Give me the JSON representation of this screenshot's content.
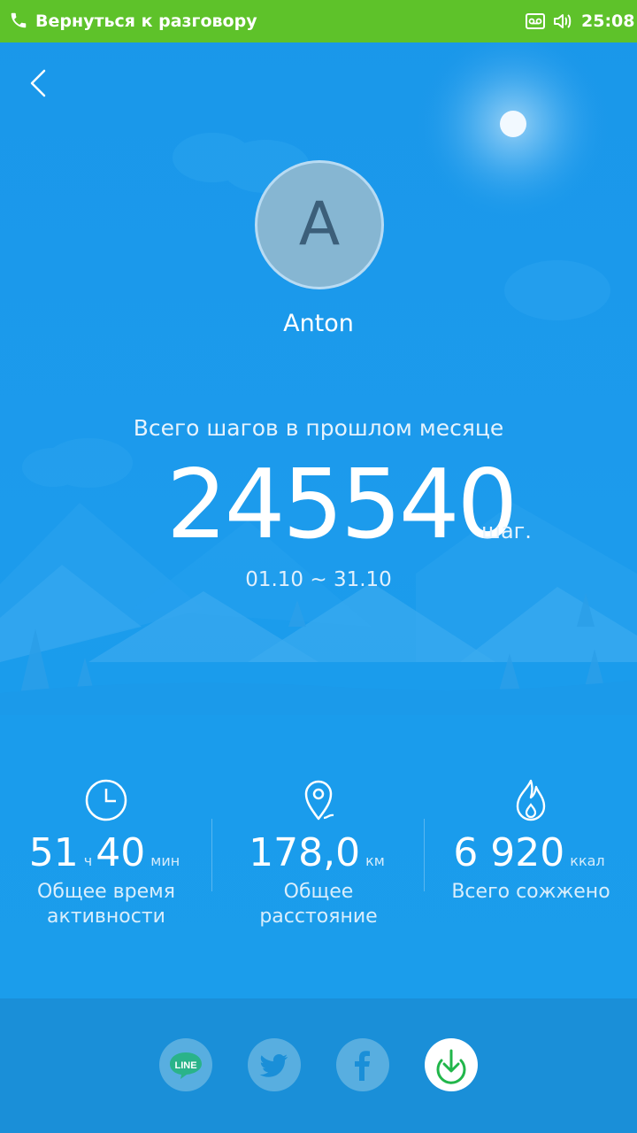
{
  "status_bar": {
    "call_text": "Вернуться к разговору",
    "time": "25:08",
    "icons": [
      "phone-icon",
      "voicemail-icon",
      "volume-icon"
    ]
  },
  "header": {
    "back_icon": "chevron-left-icon"
  },
  "profile": {
    "avatar_letter": "A",
    "name": "Anton"
  },
  "summary": {
    "label": "Всего шагов в прошлом месяце",
    "steps": "245540",
    "unit": "шаг.",
    "period": "01.10 ~ 31.10"
  },
  "stats": [
    {
      "icon": "clock-icon",
      "hours": "51",
      "hours_unit": "ч",
      "minutes": "40",
      "minutes_unit": "мин",
      "label": "Общее время активности"
    },
    {
      "icon": "location-pin-icon",
      "value": "178,0",
      "unit": "км",
      "label": "Общее расстояние"
    },
    {
      "icon": "flame-icon",
      "value": "6 920",
      "unit": "ккал",
      "label": "Всего сожжено"
    }
  ],
  "share": {
    "buttons": [
      {
        "icon": "line-icon",
        "label": "LINE"
      },
      {
        "icon": "twitter-icon"
      },
      {
        "icon": "facebook-icon"
      },
      {
        "icon": "download-icon"
      }
    ]
  },
  "colors": {
    "status_bar": "#5ec22a",
    "background": "#1a9aea",
    "share_bar": "#1a8fd8",
    "download_accent": "#21b64a"
  }
}
